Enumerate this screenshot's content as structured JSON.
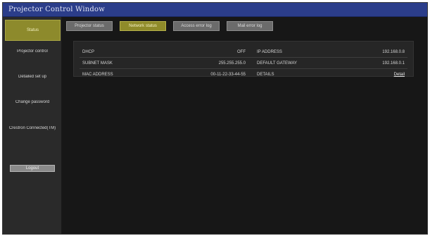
{
  "window": {
    "title": "Projector Control Window"
  },
  "sidebar": {
    "items": [
      {
        "label": "Status",
        "active": true
      },
      {
        "label": "Projector control"
      },
      {
        "label": "Detailed set up"
      },
      {
        "label": "Change password"
      },
      {
        "label": "Crestron Connected(TM)"
      }
    ],
    "button_label": "Logout"
  },
  "tabs": [
    {
      "label": "Projector status",
      "active": false
    },
    {
      "label": "Network status",
      "active": true
    },
    {
      "label": "Access error log",
      "active": false
    },
    {
      "label": "Mail error log",
      "active": false
    }
  ],
  "status_rows": [
    {
      "label_left": "DHCP",
      "value_left": "OFF",
      "label_right": "IP ADDRESS",
      "value_right": "192.168.0.8"
    },
    {
      "label_left": "SUBNET MASK",
      "value_left": "255.255.255.0",
      "label_right": "DEFAULT GATEWAY",
      "value_right": "192.168.0.1"
    },
    {
      "label_left": "MAC ADDRESS",
      "value_left": "00-11-22-33-44-55",
      "label_right": "DETAILS",
      "value_right": "Detail"
    }
  ],
  "colors": {
    "titlebar": "#2b3d8a",
    "accent": "#8f8b2a",
    "background": "#171717",
    "panel": "#262626"
  }
}
